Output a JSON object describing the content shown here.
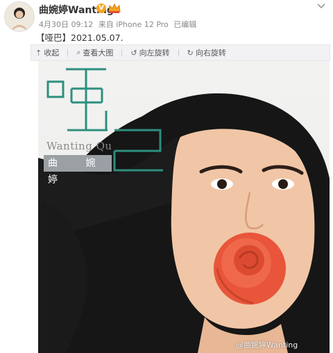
{
  "post": {
    "username": "曲婉婷Wanting",
    "verified_badge": "V",
    "date": "4月30日 09:12",
    "source": "来自 iPhone 12 Pro",
    "edited": "已编辑",
    "text": "【哑巴】2021.05.07."
  },
  "toolbar": {
    "collapse_label": "收起",
    "view_large_label": "查看大图",
    "rotate_left_label": "向左旋转",
    "rotate_right_label": "向右旋转"
  },
  "image": {
    "cover_name_en": "Wanting Qu",
    "cover_name_cn": "曲 婉婷",
    "watermark": "@曲婉婷Wanting"
  },
  "icons": {
    "more": "chevron-down-icon",
    "verified": "verified-badge-icon",
    "crown": "crown-icon"
  },
  "colors": {
    "accent_teal": "#2d8f7e",
    "rose": "#e8553a",
    "hair": "#151515"
  }
}
